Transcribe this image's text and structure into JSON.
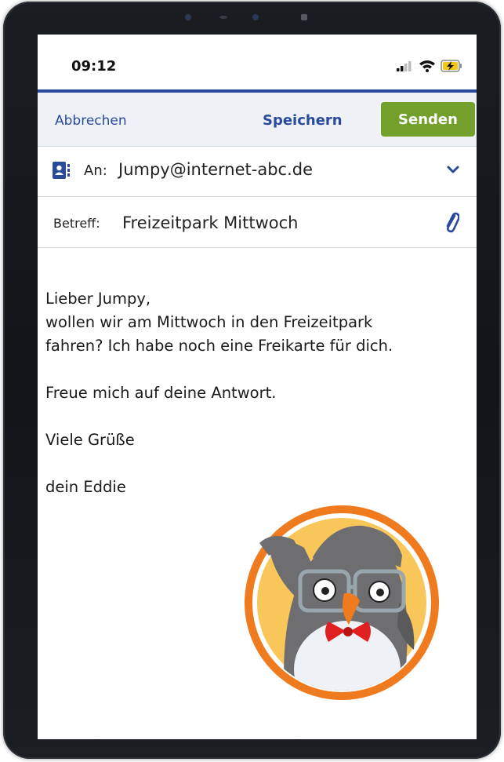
{
  "status": {
    "time": "09:12"
  },
  "toolbar": {
    "cancel_label": "Abbrechen",
    "save_label": "Speichern",
    "send_label": "Senden"
  },
  "to": {
    "label": "An:",
    "value": "Jumpy@internet-abc.de"
  },
  "subject": {
    "label": "Betreff:",
    "value": "Freizeitpark Mittwoch"
  },
  "body": {
    "greeting": "Lieber Jumpy,",
    "line1": "wollen wir am Mittwoch in den Freizeitpark",
    "line2": "fahren? Ich habe noch eine Freikarte für dich.",
    "line3": "Freue mich auf deine Antwort.",
    "closing": "Viele Grüße",
    "signature": "dein Eddie"
  },
  "colors": {
    "accent": "#2a4b9b",
    "send_button": "#72a02a",
    "toolbar_bg": "#eef2f7",
    "avatar_ring": "#f07a1e"
  },
  "icons": [
    "contact-book-icon",
    "chevron-down-icon",
    "paperclip-icon",
    "signal-icon",
    "wifi-icon",
    "battery-charging-icon"
  ]
}
